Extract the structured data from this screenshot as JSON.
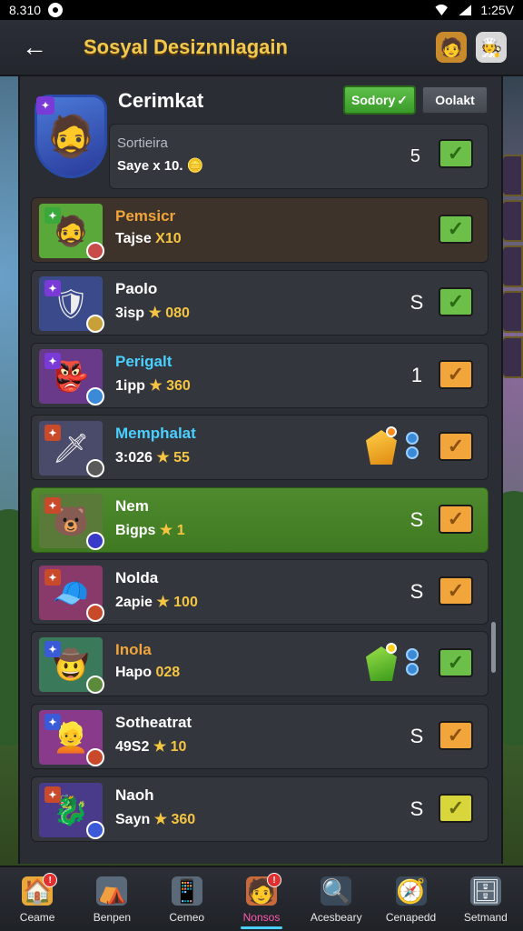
{
  "status_bar": {
    "time": "8.310",
    "battery": "1:25V"
  },
  "header": {
    "title": "Sosyal Desiznnlagain"
  },
  "featured": {
    "name": "Cerimkat",
    "primary_button": "Sodory",
    "secondary_button": "Oolakt",
    "subtitle": "Sortieira",
    "stat": "Saye x 10.",
    "count": "5"
  },
  "rows": [
    {
      "name": "Pemsicr",
      "name_color": "#f2a53a",
      "stat_a": "Tajse",
      "stat_b": " X10",
      "num": "",
      "check": "g",
      "icon": "🧔"
    },
    {
      "name": "Paolo",
      "name_color": "#ffffff",
      "stat_a": "3isp",
      "stat_b": " ★ 080",
      "num": "S",
      "check": "g",
      "icon": "🛡"
    },
    {
      "name": "Perigalt",
      "name_color": "#4ad0ff",
      "stat_a": "1ipp",
      "stat_b": " ★ 360",
      "num": "1",
      "check": "o",
      "icon": "👺"
    },
    {
      "name": "Memphalat",
      "name_color": "#4ad0ff",
      "stat_a": "3:026",
      "stat_b": " ★ 55",
      "num": "",
      "check": "o",
      "icon": "🗡"
    },
    {
      "name": "Nem",
      "name_color": "#ffffff",
      "stat_a": "Bigps",
      "stat_b": " ★ 1",
      "num": "S",
      "check": "o",
      "icon": "🐻"
    },
    {
      "name": "Nolda",
      "name_color": "#ffffff",
      "stat_a": "2apie",
      "stat_b": " ★ 100",
      "num": "S",
      "check": "o",
      "icon": "🧢"
    },
    {
      "name": "Inola",
      "name_color": "#f2a53a",
      "stat_a": "Hapo",
      "stat_b": " 028",
      "num": "",
      "check": "g",
      "icon": "🤠"
    },
    {
      "name": "Sotheatrat",
      "name_color": "#ffffff",
      "stat_a": "49S2",
      "stat_b": " ★ 10",
      "num": "S",
      "check": "o",
      "icon": "👱"
    },
    {
      "name": "Naoh",
      "name_color": "#ffffff",
      "stat_a": "Sayn",
      "stat_b": " ★ 360",
      "num": "S",
      "check": "y",
      "icon": "🐉"
    }
  ],
  "nav": [
    {
      "label": "Ceame",
      "icon": "🏠",
      "badge": "!"
    },
    {
      "label": "Benpen",
      "icon": "⛺",
      "badge": ""
    },
    {
      "label": "Cemeo",
      "icon": "📱",
      "badge": ""
    },
    {
      "label": "Nonsos",
      "icon": "🧑",
      "badge": "!",
      "active": true
    },
    {
      "label": "Acesbeary",
      "icon": "🔍",
      "badge": ""
    },
    {
      "label": "Cenapedd",
      "icon": "🧭",
      "badge": ""
    },
    {
      "label": "Setmand",
      "icon": "🗄",
      "badge": ""
    }
  ]
}
